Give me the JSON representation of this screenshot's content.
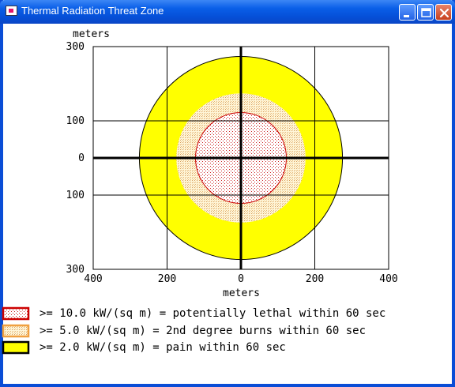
{
  "window": {
    "title": "Thermal Radiation Threat Zone",
    "buttons": {
      "minimize": "minimize",
      "maximize": "maximize",
      "close": "close"
    }
  },
  "chart_data": {
    "type": "threat-zone-map",
    "x_unit_label": "meters",
    "y_unit_label": "meters",
    "x_ticks": [
      "400",
      "200",
      "0",
      "200",
      "400"
    ],
    "y_ticks": [
      "300",
      "100",
      "0",
      "100",
      "300"
    ],
    "xlim": [
      -400,
      400
    ],
    "ylim": [
      -300,
      300
    ],
    "grid": true,
    "zones": [
      {
        "level": "red",
        "radius_m": 123,
        "color": "#cc0000",
        "fill": "dotted-red",
        "label": ">= 10.0 kW/(sq m) = potentially lethal within 60 sec"
      },
      {
        "level": "orange",
        "radius_m": 175,
        "color": "#f0a040",
        "fill": "dotted-orange",
        "label": ">= 5.0 kW/(sq m) = 2nd degree burns within 60 sec"
      },
      {
        "level": "yellow",
        "radius_m": 275,
        "color": "#ffff00",
        "fill": "solid-yellow",
        "label": ">= 2.0 kW/(sq m) = pain within 60 sec"
      }
    ]
  }
}
